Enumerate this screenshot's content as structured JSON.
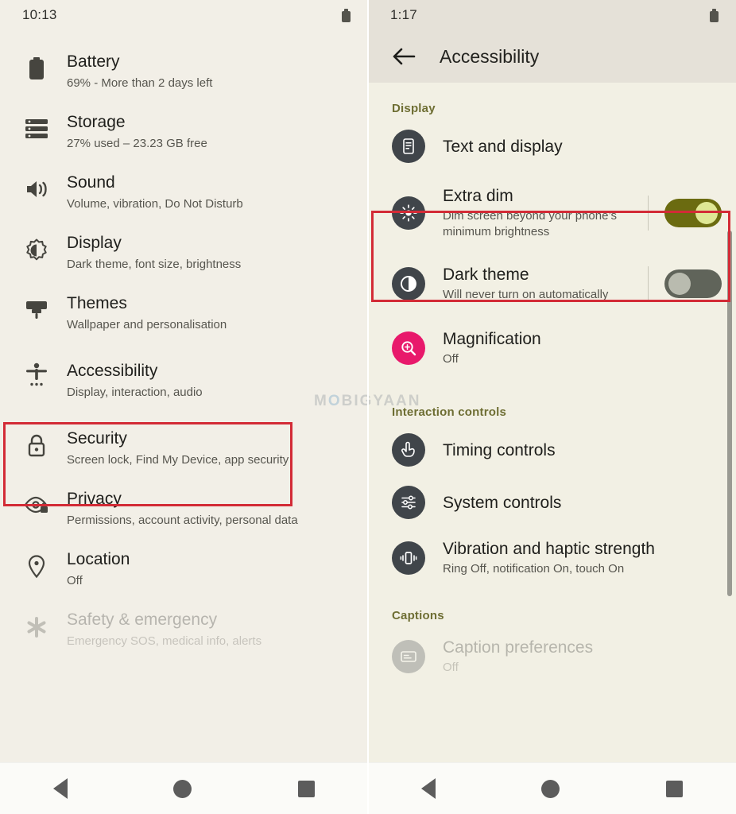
{
  "left": {
    "status": {
      "clock": "10:13",
      "battery_icon": "battery-icon"
    },
    "items": [
      {
        "title": "Battery",
        "sub": "69% - More than 2 days left",
        "icon": "battery-icon"
      },
      {
        "title": "Storage",
        "sub": "27% used – 23.23 GB free",
        "icon": "storage-icon"
      },
      {
        "title": "Sound",
        "sub": "Volume, vibration, Do Not Disturb",
        "icon": "sound-icon"
      },
      {
        "title": "Display",
        "sub": "Dark theme, font size, brightness",
        "icon": "brightness-icon"
      },
      {
        "title": "Themes",
        "sub": "Wallpaper and personalisation",
        "icon": "themes-icon"
      },
      {
        "title": "Accessibility",
        "sub": "Display, interaction, audio",
        "icon": "accessibility-icon"
      },
      {
        "title": "Security",
        "sub": "Screen lock, Find My Device, app security",
        "icon": "lock-icon"
      },
      {
        "title": "Privacy",
        "sub": "Permissions, account activity, personal data",
        "icon": "privacy-eye-icon"
      },
      {
        "title": "Location",
        "sub": "Off",
        "icon": "location-pin-icon"
      },
      {
        "title": "Safety & emergency",
        "sub": "Emergency SOS, medical info, alerts",
        "icon": "emergency-icon"
      }
    ],
    "highlight": "Accessibility"
  },
  "right": {
    "status": {
      "clock": "1:17",
      "battery_icon": "battery-icon"
    },
    "appbar": {
      "back_icon": "back-arrow-icon",
      "title": "Accessibility"
    },
    "sections": [
      {
        "label": "Display",
        "items": [
          {
            "title": "Text and display",
            "sub": "",
            "icon": "text-display-icon",
            "toggle": "none"
          },
          {
            "title": "Extra dim",
            "sub": "Dim screen beyond your phone’s minimum brightness",
            "icon": "extra-dim-icon",
            "toggle": "on"
          },
          {
            "title": "Dark theme",
            "sub": "Will never turn on automatically",
            "icon": "dark-theme-icon",
            "toggle": "off"
          },
          {
            "title": "Magnification",
            "sub": "Off",
            "icon": "magnification-icon",
            "toggle": "none"
          }
        ]
      },
      {
        "label": "Interaction controls",
        "items": [
          {
            "title": "Timing controls",
            "sub": "",
            "icon": "timing-controls-icon",
            "toggle": "none"
          },
          {
            "title": "System controls",
            "sub": "",
            "icon": "system-controls-icon",
            "toggle": "none"
          },
          {
            "title": "Vibration and haptic strength",
            "sub": "Ring Off, notification On, touch On",
            "icon": "vibration-icon",
            "toggle": "none"
          }
        ]
      },
      {
        "label": "Captions",
        "items": [
          {
            "title": "Caption preferences",
            "sub": "Off",
            "icon": "caption-icon",
            "toggle": "none"
          }
        ]
      }
    ],
    "highlight": "Extra dim"
  },
  "navbar": {
    "back": "back-nav-icon",
    "home": "home-nav-icon",
    "recents": "recents-nav-icon"
  },
  "watermark": {
    "pre": "M",
    "o": "O",
    "post": "BIGYAAN"
  },
  "colors": {
    "background": "#f2efe7",
    "appbar": "#e5e1d8",
    "highlight": "#d32b36",
    "section_label": "#6e6e33",
    "toggle_on_track": "#6b6b10",
    "toggle_on_knob": "#dfe795",
    "toggle_off_track": "#60645a",
    "toggle_off_knob": "#b9bbaf",
    "icon_circle": "#40454a",
    "icon_circle_accent": "#e8196b"
  }
}
